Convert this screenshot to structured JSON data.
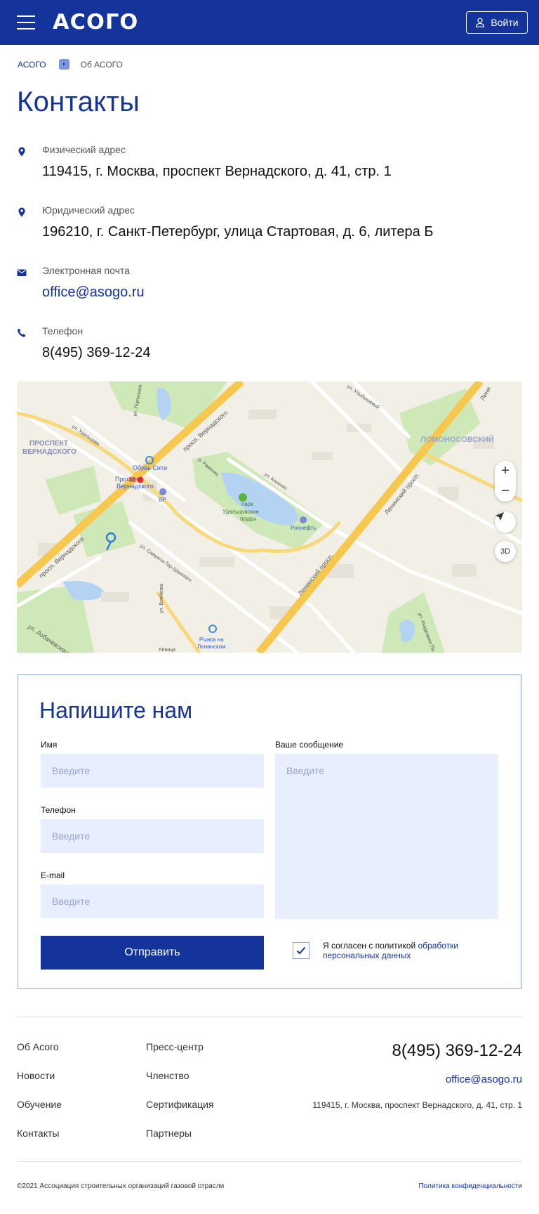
{
  "header": {
    "logo": "АСОГО",
    "login_label": "Войти"
  },
  "breadcrumb": {
    "home": "АСОГО",
    "current": "Об АСОГО"
  },
  "page_title": "Контакты",
  "contacts": [
    {
      "icon": "location-pin-icon",
      "label": "Физический адрес",
      "value": "119415, г. Москва, проспект Вернадского, д. 41, стр. 1"
    },
    {
      "icon": "location-pin-icon",
      "label": "Юридический адрес",
      "value": "196210,  г. Санкт-Петербург, улица Стартовая, д. 6, литера Б"
    },
    {
      "icon": "envelope-icon",
      "label": "Электронная почта",
      "value": "office@asogo.ru"
    },
    {
      "icon": "phone-icon",
      "label": "Телефон",
      "value": "8(495) 369-12-24"
    }
  ],
  "map": {
    "zoom_in": "+",
    "zoom_out": "−",
    "mode_3d": "3D",
    "labels": {
      "district_1": "ПРОСПЕКТ",
      "district_1b": "ВЕРНАДСКОГО",
      "district_2": "ЛОМОНОСОВСКИЙ",
      "metro": "Проспект",
      "metro_b": "Вернадского",
      "shop": "Обувь Сити",
      "bp": "BP",
      "park": "парк",
      "park_b": "Удальцовские",
      "park_c": "пруды",
      "rosneft": "Роснефть",
      "market": "Рынок на",
      "market_b": "Ленинском",
      "street_1": "просп. Вернадского",
      "street_2": "просп. Вернадского",
      "street_3": "Ленинский просп.",
      "street_4": "Ленинский просп.",
      "street_5": "ул. Удальцова",
      "street_6": "ул. Лобачевского",
      "street_7": "ул. Коненко",
      "street_8": "ул. Самуила-Тер-Шанского",
      "street_9": "ул. Воейкова",
      "street_10": "р. Раменка",
      "street_11": "ул. Академика Пи.",
      "street_12": "ул. Улыбышевой",
      "street_13": "ул. Партизана",
      "street_14": "Лени",
      "street_15": "Левица"
    }
  },
  "form": {
    "title": "Напишите нам",
    "name_label": "Имя",
    "phone_label": "Телефон",
    "email_label": "E-mail",
    "message_label": "Ваше сообщение",
    "placeholder": "Введите",
    "submit_label": "Отправить",
    "agree_text": "Я согласен с политикой ",
    "agree_link": "обработки персональных данных",
    "agree_checked": true
  },
  "footer": {
    "nav_col1": [
      "Об Асого",
      "Новости",
      "Обучение",
      "Контакты"
    ],
    "nav_col2": [
      "Пресс-центр",
      "Членство",
      "Сертификация",
      "Партнеры"
    ],
    "phone": "8(495) 369-12-24",
    "email": "office@asogo.ru",
    "address": "119415, г. Москва, проспект Вернадского, д. 41, стр. 1",
    "copyright": "©2021 Ассоциация строительных организаций газовой отрасли",
    "privacy": "Политика конфиденциальности"
  },
  "colors": {
    "brand": "#14339b",
    "input_bg": "#e8eefd",
    "border": "#8fa3dc"
  }
}
